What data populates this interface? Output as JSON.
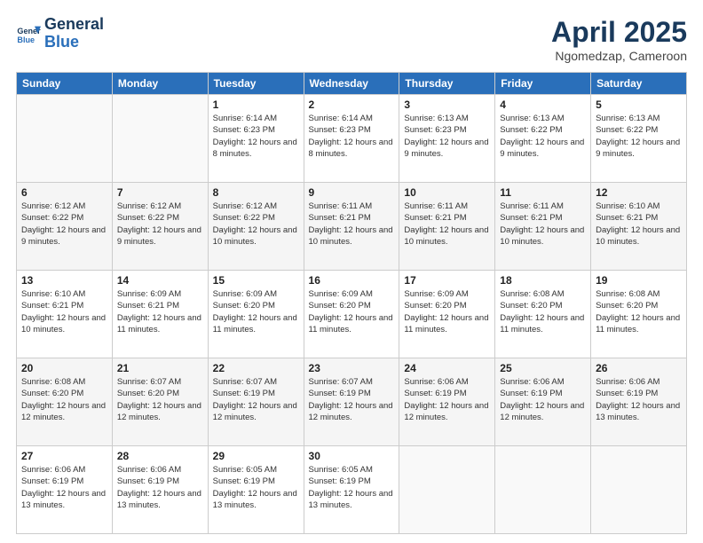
{
  "logo": {
    "line1": "General",
    "line2": "Blue"
  },
  "title": "April 2025",
  "subtitle": "Ngomedzap, Cameroon",
  "days_of_week": [
    "Sunday",
    "Monday",
    "Tuesday",
    "Wednesday",
    "Thursday",
    "Friday",
    "Saturday"
  ],
  "weeks": [
    [
      {
        "day": "",
        "info": ""
      },
      {
        "day": "",
        "info": ""
      },
      {
        "day": "1",
        "info": "Sunrise: 6:14 AM\nSunset: 6:23 PM\nDaylight: 12 hours and 8 minutes."
      },
      {
        "day": "2",
        "info": "Sunrise: 6:14 AM\nSunset: 6:23 PM\nDaylight: 12 hours and 8 minutes."
      },
      {
        "day": "3",
        "info": "Sunrise: 6:13 AM\nSunset: 6:23 PM\nDaylight: 12 hours and 9 minutes."
      },
      {
        "day": "4",
        "info": "Sunrise: 6:13 AM\nSunset: 6:22 PM\nDaylight: 12 hours and 9 minutes."
      },
      {
        "day": "5",
        "info": "Sunrise: 6:13 AM\nSunset: 6:22 PM\nDaylight: 12 hours and 9 minutes."
      }
    ],
    [
      {
        "day": "6",
        "info": "Sunrise: 6:12 AM\nSunset: 6:22 PM\nDaylight: 12 hours and 9 minutes."
      },
      {
        "day": "7",
        "info": "Sunrise: 6:12 AM\nSunset: 6:22 PM\nDaylight: 12 hours and 9 minutes."
      },
      {
        "day": "8",
        "info": "Sunrise: 6:12 AM\nSunset: 6:22 PM\nDaylight: 12 hours and 10 minutes."
      },
      {
        "day": "9",
        "info": "Sunrise: 6:11 AM\nSunset: 6:21 PM\nDaylight: 12 hours and 10 minutes."
      },
      {
        "day": "10",
        "info": "Sunrise: 6:11 AM\nSunset: 6:21 PM\nDaylight: 12 hours and 10 minutes."
      },
      {
        "day": "11",
        "info": "Sunrise: 6:11 AM\nSunset: 6:21 PM\nDaylight: 12 hours and 10 minutes."
      },
      {
        "day": "12",
        "info": "Sunrise: 6:10 AM\nSunset: 6:21 PM\nDaylight: 12 hours and 10 minutes."
      }
    ],
    [
      {
        "day": "13",
        "info": "Sunrise: 6:10 AM\nSunset: 6:21 PM\nDaylight: 12 hours and 10 minutes."
      },
      {
        "day": "14",
        "info": "Sunrise: 6:09 AM\nSunset: 6:21 PM\nDaylight: 12 hours and 11 minutes."
      },
      {
        "day": "15",
        "info": "Sunrise: 6:09 AM\nSunset: 6:20 PM\nDaylight: 12 hours and 11 minutes."
      },
      {
        "day": "16",
        "info": "Sunrise: 6:09 AM\nSunset: 6:20 PM\nDaylight: 12 hours and 11 minutes."
      },
      {
        "day": "17",
        "info": "Sunrise: 6:09 AM\nSunset: 6:20 PM\nDaylight: 12 hours and 11 minutes."
      },
      {
        "day": "18",
        "info": "Sunrise: 6:08 AM\nSunset: 6:20 PM\nDaylight: 12 hours and 11 minutes."
      },
      {
        "day": "19",
        "info": "Sunrise: 6:08 AM\nSunset: 6:20 PM\nDaylight: 12 hours and 11 minutes."
      }
    ],
    [
      {
        "day": "20",
        "info": "Sunrise: 6:08 AM\nSunset: 6:20 PM\nDaylight: 12 hours and 12 minutes."
      },
      {
        "day": "21",
        "info": "Sunrise: 6:07 AM\nSunset: 6:20 PM\nDaylight: 12 hours and 12 minutes."
      },
      {
        "day": "22",
        "info": "Sunrise: 6:07 AM\nSunset: 6:19 PM\nDaylight: 12 hours and 12 minutes."
      },
      {
        "day": "23",
        "info": "Sunrise: 6:07 AM\nSunset: 6:19 PM\nDaylight: 12 hours and 12 minutes."
      },
      {
        "day": "24",
        "info": "Sunrise: 6:06 AM\nSunset: 6:19 PM\nDaylight: 12 hours and 12 minutes."
      },
      {
        "day": "25",
        "info": "Sunrise: 6:06 AM\nSunset: 6:19 PM\nDaylight: 12 hours and 12 minutes."
      },
      {
        "day": "26",
        "info": "Sunrise: 6:06 AM\nSunset: 6:19 PM\nDaylight: 12 hours and 13 minutes."
      }
    ],
    [
      {
        "day": "27",
        "info": "Sunrise: 6:06 AM\nSunset: 6:19 PM\nDaylight: 12 hours and 13 minutes."
      },
      {
        "day": "28",
        "info": "Sunrise: 6:06 AM\nSunset: 6:19 PM\nDaylight: 12 hours and 13 minutes."
      },
      {
        "day": "29",
        "info": "Sunrise: 6:05 AM\nSunset: 6:19 PM\nDaylight: 12 hours and 13 minutes."
      },
      {
        "day": "30",
        "info": "Sunrise: 6:05 AM\nSunset: 6:19 PM\nDaylight: 12 hours and 13 minutes."
      },
      {
        "day": "",
        "info": ""
      },
      {
        "day": "",
        "info": ""
      },
      {
        "day": "",
        "info": ""
      }
    ]
  ]
}
